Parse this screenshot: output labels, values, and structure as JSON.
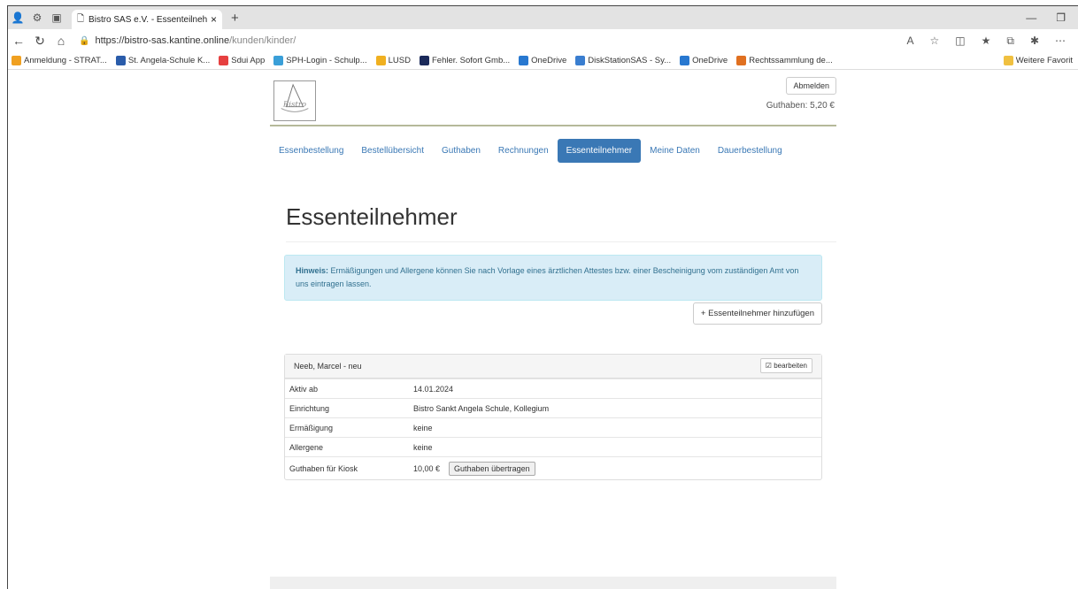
{
  "browser": {
    "tab_title": "Bistro SAS e.V. - Essenteilnehmer",
    "tab_close": "×",
    "new_tab": "+",
    "url_host": "https://bistro-sas.kantine.online",
    "url_path": "/kunden/kinder/",
    "bookmarks": [
      {
        "label": "Anmeldung - STRAT...",
        "color": "#f0a020"
      },
      {
        "label": "St. Angela-Schule K...",
        "color": "#2a5caa"
      },
      {
        "label": "Sdui App",
        "color": "#e64040"
      },
      {
        "label": "SPH-Login - Schulp...",
        "color": "#3a9fd8"
      },
      {
        "label": "LUSD",
        "color": "#f0b020"
      },
      {
        "label": "Fehler. Sofort Gmb...",
        "color": "#1b2a5a"
      },
      {
        "label": "OneDrive",
        "color": "#2878d0"
      },
      {
        "label": "DiskStationSAS - Sy...",
        "color": "#3a7ed0"
      },
      {
        "label": "OneDrive",
        "color": "#2878d0"
      },
      {
        "label": "Rechtssammlung de...",
        "color": "#e07020"
      }
    ],
    "bookmarks_more": "Weitere Favorit"
  },
  "header": {
    "logout": "Abmelden",
    "credit": "Guthaben: 5,20 €",
    "logo_text": "Bistro"
  },
  "nav": [
    {
      "label": "Essenbestellung",
      "active": false
    },
    {
      "label": "Bestellübersicht",
      "active": false
    },
    {
      "label": "Guthaben",
      "active": false
    },
    {
      "label": "Rechnungen",
      "active": false
    },
    {
      "label": "Essenteilnehmer",
      "active": true
    },
    {
      "label": "Meine Daten",
      "active": false
    },
    {
      "label": "Dauerbestellung",
      "active": false
    }
  ],
  "main": {
    "title": "Essenteilnehmer",
    "alert_strong": "Hinweis:",
    "alert_text": " Ermäßigungen und Allergene können Sie nach Vorlage eines ärztlichen Attestes bzw. einer Bescheinigung vom zuständigen Amt von uns eintragen lassen.",
    "add_button": "+ Essenteilnehmer hinzufügen",
    "participant": {
      "name": "Neeb, Marcel - neu",
      "edit": "bearbeiten",
      "rows": [
        {
          "label": "Aktiv ab",
          "value": "14.01.2024"
        },
        {
          "label": "Einrichtung",
          "value": "Bistro Sankt Angela Schule, Kollegium"
        },
        {
          "label": "Ermäßigung",
          "value": "keine"
        },
        {
          "label": "Allergene",
          "value": "keine"
        },
        {
          "label": "Guthaben für Kiosk",
          "value": "10,00 €"
        }
      ],
      "transfer_button": "Guthaben übertragen"
    }
  }
}
